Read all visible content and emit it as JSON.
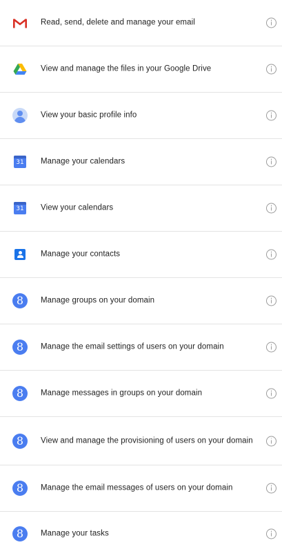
{
  "permissions": [
    {
      "label": "Read, send, delete and manage your email",
      "icon": "gmail-icon"
    },
    {
      "label": "View and manage the files in your Google Drive",
      "icon": "google-drive-icon"
    },
    {
      "label": "View your basic profile info",
      "icon": "profile-icon"
    },
    {
      "label": "Manage your calendars",
      "icon": "calendar-icon",
      "calendar_day": "31"
    },
    {
      "label": "View your calendars",
      "icon": "calendar-icon",
      "calendar_day": "31"
    },
    {
      "label": "Manage your contacts",
      "icon": "contacts-icon"
    },
    {
      "label": "Manage groups on your domain",
      "icon": "google-g-icon",
      "glyph": "8"
    },
    {
      "label": "Manage the email settings of users on your domain",
      "icon": "google-g-icon",
      "glyph": "8"
    },
    {
      "label": "Manage messages in groups on your domain",
      "icon": "google-g-icon",
      "glyph": "8"
    },
    {
      "label": "View and manage the provisioning of users on your domain",
      "icon": "google-g-icon",
      "glyph": "8"
    },
    {
      "label": "Manage the email messages of users on your domain",
      "icon": "google-g-icon",
      "glyph": "8"
    },
    {
      "label": "Manage your tasks",
      "icon": "google-g-icon",
      "glyph": "8"
    }
  ],
  "colors": {
    "gmail_red": "#d93025",
    "google_blue": "#4a7df0",
    "divider": "#e3e3e3",
    "info_icon": "#9a9a9a"
  }
}
